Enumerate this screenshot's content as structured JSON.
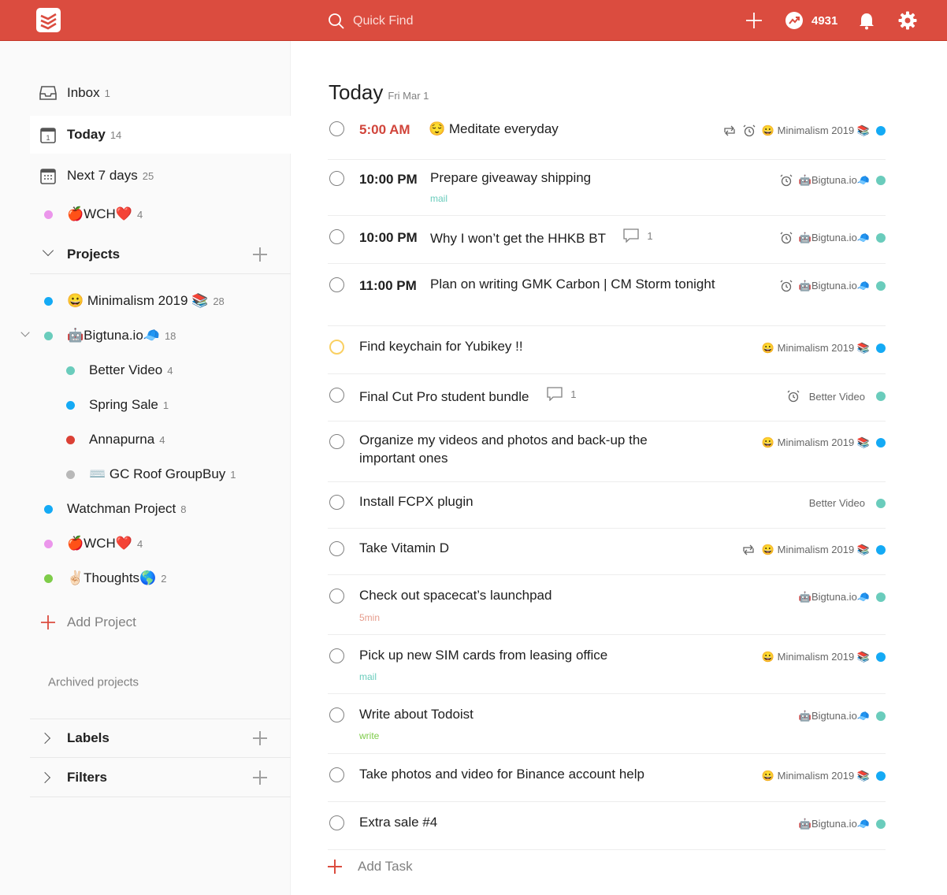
{
  "header": {
    "search_placeholder": "Quick Find",
    "karma": "4931"
  },
  "colors": {
    "brand": "#db4c3f",
    "blue": "#14aaf5",
    "teal": "#6accbc",
    "pink": "#eb96eb",
    "red": "#db4035",
    "gray": "#b8b8b8",
    "green": "#7ecc49"
  },
  "sidebar": {
    "inbox": {
      "label": "Inbox",
      "count": "1"
    },
    "today": {
      "label": "Today",
      "count": "14"
    },
    "next7": {
      "label": "Next 7 days",
      "count": "25"
    },
    "favorite": {
      "label": "🍎WCH❤️",
      "count": "4"
    },
    "projects_header": "Projects",
    "projects": [
      {
        "label": "😀 Minimalism 2019 📚",
        "count": "28"
      },
      {
        "label": "🤖Bigtuna.io🧢",
        "count": "18"
      },
      {
        "label": "Better Video",
        "count": "4"
      },
      {
        "label": "Spring Sale",
        "count": "1"
      },
      {
        "label": "Annapurna",
        "count": "4"
      },
      {
        "label": "⌨️ GC Roof GroupBuy",
        "count": "1"
      },
      {
        "label": "Watchman Project",
        "count": "8"
      },
      {
        "label": "🍎WCH❤️",
        "count": "4"
      },
      {
        "label": "✌🏻Thoughts🌎",
        "count": "2"
      }
    ],
    "add_project": "Add Project",
    "archived": "Archived projects",
    "labels_header": "Labels",
    "filters_header": "Filters"
  },
  "main": {
    "title": "Today",
    "date": "Fri Mar 1",
    "tasks": [
      {
        "time": "5:00 AM",
        "content": "😌 Meditate everyday",
        "project": "😀 Minimalism 2019 📚"
      },
      {
        "time": "10:00 PM",
        "content": "Prepare giveaway shipping",
        "label": "mail",
        "project": "🤖Bigtuna.io🧢"
      },
      {
        "time": "10:00 PM",
        "content": "Why I won’t get the HHKB BT",
        "comments": "1",
        "project": "🤖Bigtuna.io🧢"
      },
      {
        "time": "11:00 PM",
        "content": "Plan on writing GMK Carbon | CM Storm tonight",
        "project": "🤖Bigtuna.io🧢"
      },
      {
        "content": "Find keychain for Yubikey !!",
        "project": "😀 Minimalism 2019 📚"
      },
      {
        "content": "Final Cut Pro student bundle",
        "comments": "1",
        "project": "Better Video"
      },
      {
        "content": "Organize my videos and photos and back-up the important ones",
        "project": "😀 Minimalism 2019 📚"
      },
      {
        "content": "Install FCPX plugin",
        "project": "Better Video"
      },
      {
        "content": "Take Vitamin D",
        "project": "😀 Minimalism 2019 📚"
      },
      {
        "content": "Check out spacecat’s launchpad",
        "label": "5min",
        "project": "🤖Bigtuna.io🧢"
      },
      {
        "content": "Pick up new SIM cards from leasing office",
        "label": "mail",
        "project": "😀 Minimalism 2019 📚"
      },
      {
        "content": "Write about Todoist",
        "label": "write",
        "project": "🤖Bigtuna.io🧢"
      },
      {
        "content": "Take photos and video for Binance account help",
        "project": "😀 Minimalism 2019 📚"
      },
      {
        "content": "Extra sale #4",
        "project": "🤖Bigtuna.io🧢"
      }
    ],
    "add_task": "Add Task"
  }
}
